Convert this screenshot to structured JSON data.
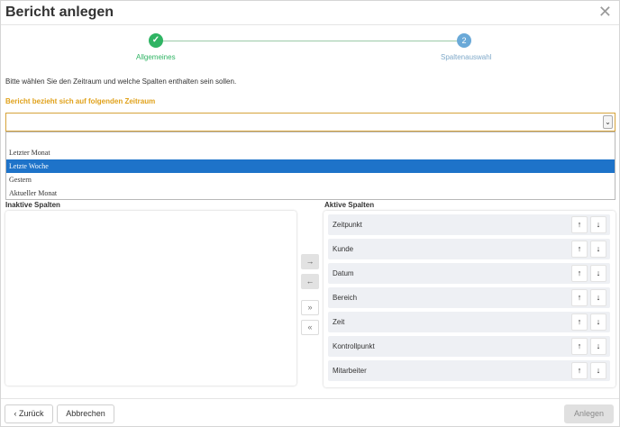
{
  "dialog": {
    "title": "Bericht anlegen",
    "close_glyph": "✕"
  },
  "steps": [
    {
      "number": "✓",
      "label": "Allgemeines",
      "state": "done"
    },
    {
      "number": "2",
      "label": "Spaltenauswahl",
      "state": "current"
    }
  ],
  "instruction": "Bitte wählen Sie den Zeitraum und welche Spalten enthalten sein sollen.",
  "period": {
    "label": "Bericht bezieht sich auf folgenden Zeitraum",
    "value": "",
    "arrow_glyph": "⌄",
    "options": [
      "",
      "Letzter Monat",
      "Letzte Woche",
      "Gestern",
      "Aktueller Monat"
    ],
    "highlighted": "Letzte Woche"
  },
  "inactive": {
    "header": "Inaktive Spalten",
    "items": []
  },
  "transfer_buttons": {
    "move_right": "→",
    "move_left": "←",
    "move_all_right": "»",
    "move_all_left": "«"
  },
  "active": {
    "header": "Aktive Spalten",
    "up_glyph": "↑",
    "down_glyph": "↓",
    "items": [
      "Zeitpunkt",
      "Kunde",
      "Datum",
      "Bereich",
      "Zeit",
      "Kontrollpunkt",
      "Mitarbeiter"
    ]
  },
  "footer": {
    "back_label": "‹ Zurück",
    "cancel_label": "Abbrechen",
    "create_label": "Anlegen"
  },
  "colors": {
    "accent_label": "#e0a11a",
    "step_done": "#2fb463",
    "step_current": "#6aa9d8",
    "selection": "#1e73c9"
  }
}
